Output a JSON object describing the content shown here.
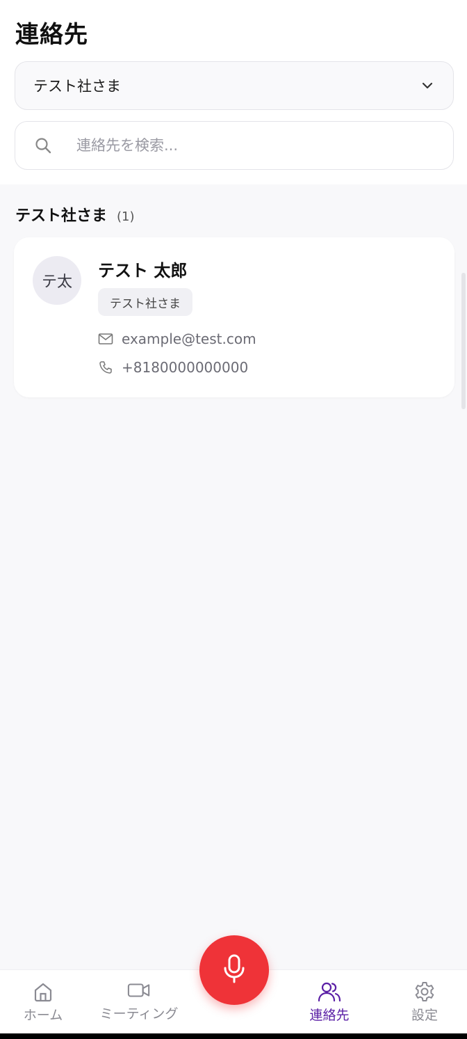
{
  "header": {
    "title": "連絡先",
    "company_select": {
      "value": "テスト社さま",
      "icon": "chevron-down-icon"
    },
    "search": {
      "placeholder": "連絡先を検索...",
      "value": "",
      "icon": "search-icon"
    }
  },
  "group": {
    "name": "テスト社さま",
    "count": "(1)"
  },
  "contacts": [
    {
      "avatar_initials": "テ太",
      "name": "テスト 太郎",
      "company": "テスト社さま",
      "email": "example@test.com",
      "phone": "+8180000000000"
    }
  ],
  "bottom_nav": {
    "items": [
      {
        "label": "ホーム",
        "icon": "home-icon"
      },
      {
        "label": "ミーティング",
        "icon": "video-camera-icon"
      },
      {
        "label": "連絡先",
        "icon": "users-icon",
        "active": true
      },
      {
        "label": "設定",
        "icon": "gear-icon"
      }
    ],
    "center_button_icon": "microphone-icon"
  },
  "colors": {
    "accent": "#5a1ea5",
    "record": "#ef3338",
    "background": "#f8f8fa"
  }
}
